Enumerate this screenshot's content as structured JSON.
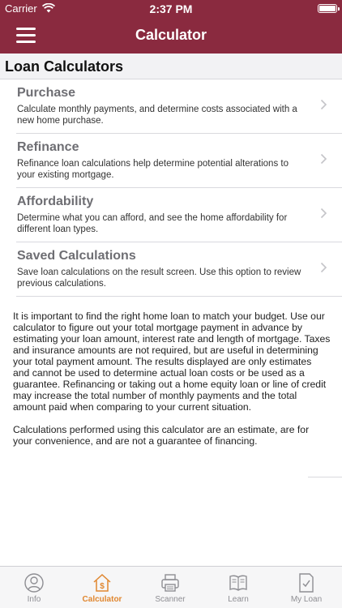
{
  "status": {
    "carrier": "Carrier",
    "time": "2:37 PM",
    "battery_level": 1.0
  },
  "navbar": {
    "menu_icon": "hamburger-menu-icon",
    "title": "Calculator"
  },
  "section": {
    "header": "Loan Calculators"
  },
  "calculators": [
    {
      "title": "Purchase",
      "description": "Calculate monthly payments, and determine costs associated with a new home purchase."
    },
    {
      "title": "Refinance",
      "description": "Refinance loan calculations help determine potential alterations to your existing mortgage."
    },
    {
      "title": "Affordability",
      "description": "Determine what you can afford, and see the home affordability for different loan types."
    },
    {
      "title": "Saved Calculations",
      "description": "Save loan calculations on the result screen. Use this option to review previous calculations."
    }
  ],
  "info": {
    "paragraph1": "It is important to find the right home loan to match your budget. Use our calculator to figure out your total mortgage payment in advance by estimating your loan amount, interest rate and length of mortgage. Taxes and insurance amounts are not required, but are useful in determining your total payment amount.  The results displayed are only estimates and cannot be used to determine actual loan costs or be used as a guarantee. Refinancing or taking out a home equity loan or line of credit may increase the total number of monthly payments and the total amount paid when comparing to your current situation.",
    "paragraph2": "Calculations performed using this calculator are an estimate, are for your convenience, and are not a guarantee of financing."
  },
  "tabs": [
    {
      "label": "Info",
      "icon": "person-icon",
      "active": false
    },
    {
      "label": "Calculator",
      "icon": "house-dollar-icon",
      "active": true
    },
    {
      "label": "Scanner",
      "icon": "printer-scanner-icon",
      "active": false
    },
    {
      "label": "Learn",
      "icon": "open-book-icon",
      "active": false
    },
    {
      "label": "My Loan",
      "icon": "document-check-icon",
      "active": false
    }
  ],
  "colors": {
    "brand": "#8a2a3f",
    "active_tab": "#e08730",
    "inactive_tab": "#8e8e93"
  }
}
